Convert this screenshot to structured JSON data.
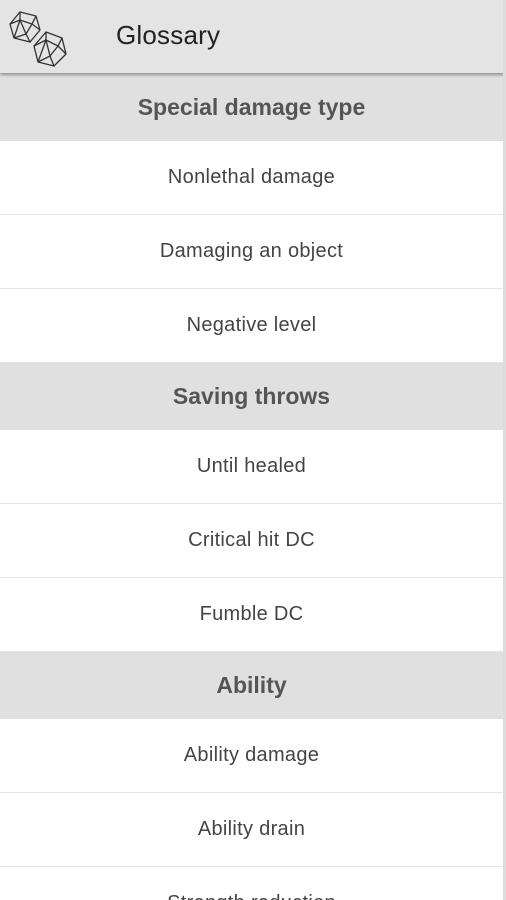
{
  "toolbar": {
    "title": "Glossary",
    "icon": "dice-icon"
  },
  "sections": [
    {
      "header": "Special damage type",
      "items": [
        "Nonlethal damage",
        "Damaging an object",
        "Negative level"
      ]
    },
    {
      "header": "Saving throws",
      "items": [
        "Until healed",
        "Critical hit DC",
        "Fumble DC"
      ]
    },
    {
      "header": "Ability",
      "items": [
        "Ability damage",
        "Ability drain",
        "Strength reduction"
      ]
    }
  ]
}
